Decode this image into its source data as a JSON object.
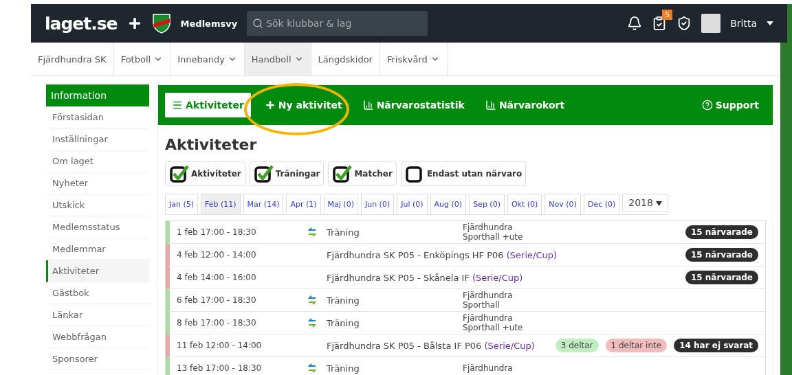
{
  "header": {
    "logo": "laget.se",
    "view": "Medlemsvy",
    "search": {
      "placeholder": "Sök klubbar & lag"
    },
    "task_count": "5",
    "user": "Britta"
  },
  "nav": [
    {
      "label": "Fjärdhundra SK",
      "dropdown": false,
      "selected": false
    },
    {
      "label": "Fotboll",
      "dropdown": true,
      "selected": false
    },
    {
      "label": "Innebandy",
      "dropdown": true,
      "selected": false
    },
    {
      "label": "Handboll",
      "dropdown": true,
      "selected": true
    },
    {
      "label": "Längdskidor",
      "dropdown": false,
      "selected": false
    },
    {
      "label": "Friskvård",
      "dropdown": true,
      "selected": false
    }
  ],
  "sidebar": {
    "title": "Information",
    "items": [
      {
        "label": "Förstasidan",
        "selected": false
      },
      {
        "label": "Inställningar",
        "selected": false
      },
      {
        "label": "Om laget",
        "selected": false
      },
      {
        "label": "Nyheter",
        "selected": false
      },
      {
        "label": "Utskick",
        "selected": false
      },
      {
        "label": "Medlemsstatus",
        "selected": false
      },
      {
        "label": "Medlemmar",
        "selected": false
      },
      {
        "label": "Aktiviteter",
        "selected": true
      },
      {
        "label": "Gästbok",
        "selected": false
      },
      {
        "label": "Länkar",
        "selected": false
      },
      {
        "label": "Webbfrågan",
        "selected": false
      },
      {
        "label": "Sponsorer",
        "selected": false
      }
    ]
  },
  "toolbar": [
    {
      "label": "Aktiviteter",
      "selected": true
    },
    {
      "label": "Ny aktivitet",
      "selected": false
    },
    {
      "label": "Närvarostatistik",
      "selected": false
    },
    {
      "label": "Närvarokort",
      "selected": false
    },
    {
      "label": "Support",
      "selected": false
    }
  ],
  "title": "Aktiviteter",
  "filters": [
    {
      "label": "Aktiviteter",
      "checked": true
    },
    {
      "label": "Träningar",
      "checked": true
    },
    {
      "label": "Matcher",
      "checked": true
    },
    {
      "label": "Endast utan närvaro",
      "checked": false
    }
  ],
  "months": [
    {
      "label": "Jan (5)",
      "selected": false
    },
    {
      "label": "Feb (11)",
      "selected": true
    },
    {
      "label": "Mar (14)",
      "selected": false
    },
    {
      "label": "Apr (1)",
      "selected": false
    },
    {
      "label": "Maj (0)",
      "selected": false
    },
    {
      "label": "Jun (0)",
      "selected": false
    },
    {
      "label": "Jul (0)",
      "selected": false
    },
    {
      "label": "Aug (0)",
      "selected": false
    },
    {
      "label": "Sep (0)",
      "selected": false
    },
    {
      "label": "Okt (0)",
      "selected": false
    },
    {
      "label": "Nov (0)",
      "selected": false
    },
    {
      "label": "Dec (0)",
      "selected": false
    }
  ],
  "year": "2018",
  "activities": [
    {
      "kind": "training",
      "time": "1 feb 17:00 - 18:30",
      "title": "Träning",
      "location": "Fjärdhundra Sporthall +ute",
      "badges": [
        {
          "kind": "dark",
          "label": "15 närvarade"
        }
      ]
    },
    {
      "kind": "match",
      "time": "4 feb 12:00 - 14:00",
      "title": "Fjärdhundra SK P05 - Enköpings HF P06",
      "link": "(Serie/Cup)",
      "badges": [
        {
          "kind": "dark",
          "label": "15 närvarade"
        }
      ]
    },
    {
      "kind": "match",
      "time": "4 feb 14:00 - 16:00",
      "title": "Fjärdhundra SK P05 - Skånela IF",
      "link": "(Serie/Cup)",
      "badges": [
        {
          "kind": "dark",
          "label": "15 närvarade"
        }
      ]
    },
    {
      "kind": "training",
      "time": "6 feb 17:00 - 18:30",
      "title": "Träning",
      "location": "Fjärdhundra Sporthall"
    },
    {
      "kind": "training",
      "time": "8 feb 17:00 - 18:30",
      "title": "Träning",
      "location": "Fjärdhundra Sporthall +ute"
    },
    {
      "kind": "match",
      "time": "11 feb 12:00 - 14:00",
      "title": "Fjärdhundra SK P05 - Bålsta IF P06",
      "link": "(Serie/Cup)",
      "badges": [
        {
          "kind": "green",
          "label": "3 deltar"
        },
        {
          "kind": "red",
          "label": "1 deltar inte"
        },
        {
          "kind": "dark",
          "label": "14 har ej svarat"
        }
      ]
    },
    {
      "kind": "training",
      "time": "13 feb 17:00 - 18:30",
      "title": "Träning",
      "location": "Fjärdhundra"
    }
  ]
}
